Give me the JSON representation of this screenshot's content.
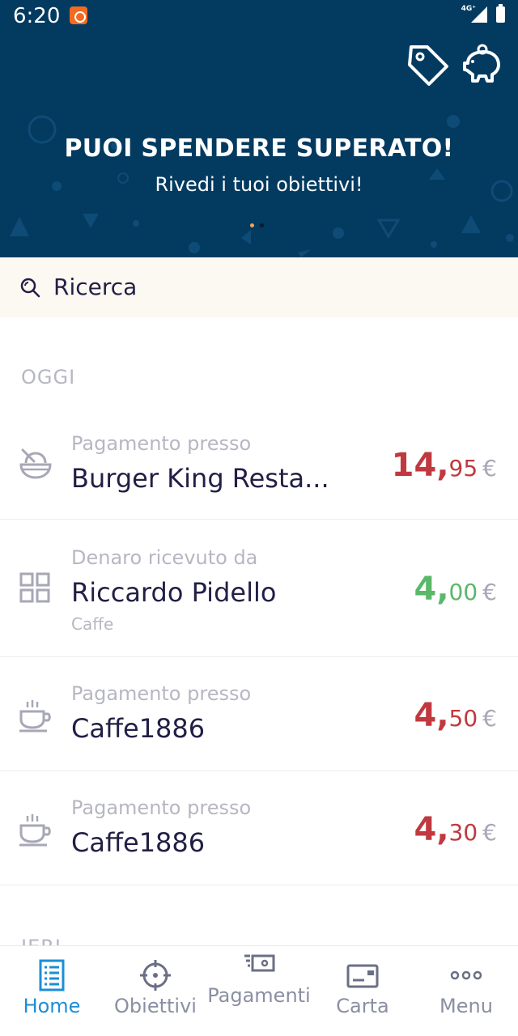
{
  "status_bar": {
    "time": "6:20",
    "network": "4G⁺"
  },
  "hero": {
    "title": "PUOI SPENDERE SUPERATO!",
    "subtitle": "Rivedi i tuoi obiettivi!",
    "icons": [
      "tag-icon",
      "piggy-bank-icon"
    ],
    "background_color": "#033a60"
  },
  "search": {
    "label": "Ricerca",
    "icon": "search-icon"
  },
  "sections": {
    "today": "OGGI",
    "yesterday": "IERI"
  },
  "transactions": [
    {
      "top": "Pagamento presso",
      "name": "Burger King Resta...",
      "note": "",
      "amount_int": "14,",
      "amount_dec": "95",
      "currency": "€",
      "type": "negative",
      "icon": "food-bowl-icon"
    },
    {
      "top": "Denaro ricevuto da",
      "name": "Riccardo Pidello",
      "note": "Caffe",
      "amount_int": "4,",
      "amount_dec": "00",
      "currency": "€",
      "type": "positive",
      "icon": "grid-icon"
    },
    {
      "top": "Pagamento presso",
      "name": "Caffe1886",
      "note": "",
      "amount_int": "4,",
      "amount_dec": "50",
      "currency": "€",
      "type": "negative",
      "icon": "coffee-cup-icon"
    },
    {
      "top": "Pagamento presso",
      "name": "Caffe1886",
      "note": "",
      "amount_int": "4,",
      "amount_dec": "30",
      "currency": "€",
      "type": "negative",
      "icon": "coffee-cup-icon"
    }
  ],
  "bottom_nav": [
    {
      "label": "Home",
      "icon": "home-list-icon",
      "active": true
    },
    {
      "label": "Obiettivi",
      "icon": "target-icon",
      "active": false
    },
    {
      "label": "Pagamenti",
      "icon": "payments-icon",
      "active": false
    },
    {
      "label": "Carta",
      "icon": "card-icon",
      "active": false
    },
    {
      "label": "Menu",
      "icon": "more-dots-icon",
      "active": false
    }
  ],
  "colors": {
    "negative": "#c0393f",
    "positive": "#5ab86a",
    "accent": "#1d8ed6",
    "text": "#221f45"
  }
}
